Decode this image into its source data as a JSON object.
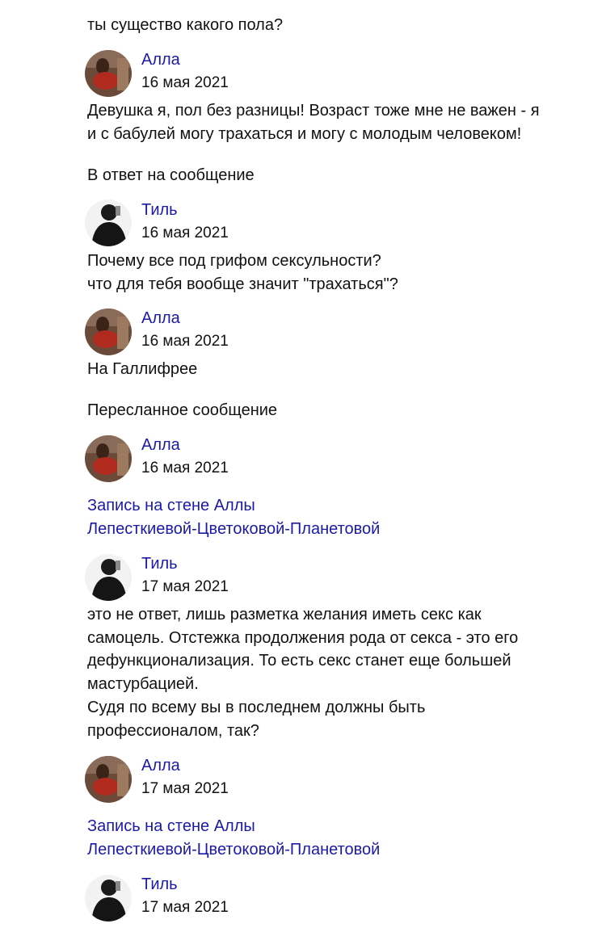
{
  "top_text": "ты существо какого пола?",
  "posts": [
    {
      "author": "Алла",
      "date": "16 мая 2021",
      "lines": [
        "Девушка я, пол без разницы! Возраст тоже мне не важен - я",
        "и с бабулей могу трахаться и могу с молодым человеком!"
      ]
    },
    {
      "label": "В ответ на сообщение",
      "author": "Тиль",
      "date": "16 мая 2021",
      "lines": [
        "Почему все под грифом сексульности?",
        "что для тебя вообще значит \"трахаться\"?"
      ]
    },
    {
      "author": "Алла",
      "date": "16 мая 2021",
      "lines": [
        "На Галлифрее"
      ]
    },
    {
      "label": "Пересланное сообщение",
      "author": "Алла",
      "date": "16 мая 2021",
      "link_lines": [
        "Запись на стене Аллы",
        "Лепесткиевой-Цветоковой-Планетовой"
      ]
    },
    {
      "author": "Тиль",
      "date": "17 мая 2021",
      "lines": [
        "это не ответ, лишь разметка желания иметь секс как",
        "самоцель. Отстежка продолжения рода от секса - это его",
        "дефункционализация. То есть секс станет еще большей",
        "мастурбацией.",
        "Судя по всему вы в последнем должны быть",
        "профессионалом, так?"
      ]
    },
    {
      "author": "Алла",
      "date": "17 мая 2021",
      "link_lines": [
        "Запись на стене Аллы",
        "Лепесткиевой-Цветоковой-Планетовой"
      ]
    },
    {
      "author": "Тиль",
      "date": "17 мая 2021"
    }
  ],
  "colors": {
    "link": "#1a1aa6",
    "text": "#111111"
  }
}
